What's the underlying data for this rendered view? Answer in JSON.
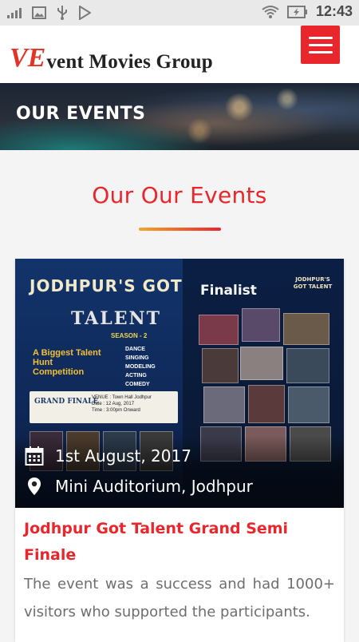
{
  "status_bar": {
    "time": "12:43",
    "left_icons": [
      "signal-icon",
      "image-icon",
      "usb-icon",
      "play-store-icon"
    ],
    "right_icons": [
      "wifi-icon",
      "battery-charging-icon"
    ]
  },
  "header": {
    "logo_mark": "VE",
    "logo_text": "vent Movies Group",
    "brand_color": "#e8262c",
    "menu_icon": "hamburger-icon"
  },
  "banner": {
    "title": "OUR EVENTS"
  },
  "section": {
    "title": "Our Our Events",
    "accent_gradient": [
      "#f3a52a",
      "#e8262c"
    ]
  },
  "event_card": {
    "poster": {
      "heading": "JODHPUR'S GOT",
      "talent": "TALENT",
      "season": "SEASON - 2",
      "big_text": "A Biggest Talent Hunt Competition",
      "categories": [
        "DANCE",
        "SINGING",
        "MODELING",
        "ACTING",
        "COMEDY"
      ],
      "grand_finale": "GRAND FINALE",
      "venue_lines": [
        "VENUE : Town Hall Jodhpur",
        "Date : 12 Aug, 2017",
        "Time : 3:00pm Onward"
      ],
      "finalist": "Finalist",
      "small_logo": "JODHPUR'S GOT TALENT"
    },
    "date": "1st August, 2017",
    "date_icon": "calendar-icon",
    "location": "Mini Auditorium, Jodhpur",
    "location_icon": "map-pin-icon",
    "title": "Jodhpur Got Talent Grand Semi Finale",
    "description": "The event was a success and had 1000+ visitors who supported the participants."
  }
}
